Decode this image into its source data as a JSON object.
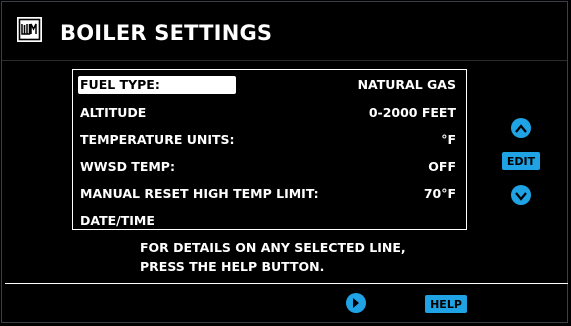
{
  "header": {
    "title": "BOILER SETTINGS",
    "logo_icon": "weil-mclain-logo"
  },
  "settings": [
    {
      "label": "FUEL TYPE:",
      "value": "NATURAL GAS",
      "selected": true
    },
    {
      "label": "ALTITUDE",
      "value": "0-2000 FEET"
    },
    {
      "label": "TEMPERATURE UNITS:",
      "value": "°F"
    },
    {
      "label": "WWSD TEMP:",
      "value": "OFF"
    },
    {
      "label": "MANUAL RESET HIGH TEMP LIMIT:",
      "value": "70°F"
    },
    {
      "label": "DATE/TIME",
      "value": ""
    }
  ],
  "help_text": {
    "line1": "FOR DETAILS ON ANY SELECTED LINE,",
    "line2": "PRESS THE HELP BUTTON."
  },
  "controls": {
    "up_icon": "chevron-up-icon",
    "down_icon": "chevron-down-icon",
    "next_icon": "play-right-icon",
    "edit_label": "EDIT",
    "help_label": "HELP"
  },
  "colors": {
    "accent": "#1fa3e5",
    "background": "#000000",
    "text": "#ffffff"
  }
}
